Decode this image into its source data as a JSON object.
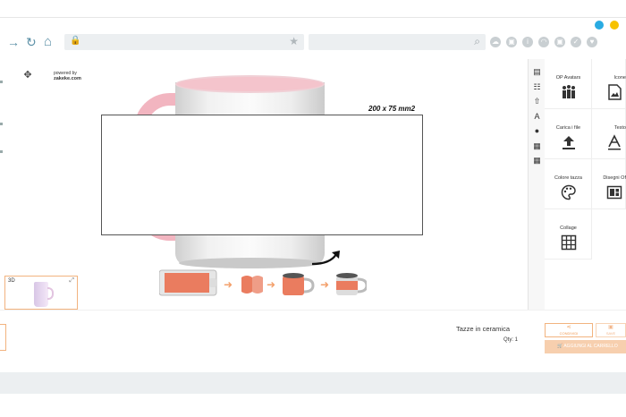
{
  "window": {
    "dot_colors": [
      "#29abe2",
      "#f7c200"
    ]
  },
  "browser": {
    "nav_icons": [
      "→",
      "↻",
      "⌂"
    ],
    "url_value": "",
    "search_value": "",
    "extension_icons": [
      "cloud-icon",
      "camera-icon",
      "info-icon",
      "wifi-icon",
      "camera-icon",
      "shield-icon",
      "heart-icon"
    ]
  },
  "brand": {
    "powered_line": "powered by",
    "brand_name": "zakeke.com"
  },
  "canvas": {
    "print_area_size": "200 x 75 mm2"
  },
  "thumbnail": {
    "label": "3D"
  },
  "tools": [
    {
      "label": "OP Avatars",
      "icon": "avatars-icon",
      "glyph": "👪"
    },
    {
      "label": "Icone",
      "icon": "image-icon",
      "glyph": "🖼"
    },
    {
      "label": "Carica i file",
      "icon": "upload-icon",
      "glyph": "⇧"
    },
    {
      "label": "Testo",
      "icon": "text-icon",
      "glyph": "A"
    },
    {
      "label": "Colore tazza",
      "icon": "palette-icon",
      "glyph": "🎨"
    },
    {
      "label": "Disegni Of",
      "icon": "layout-icon",
      "glyph": "▦"
    },
    {
      "label": "Collage",
      "icon": "grid-icon",
      "glyph": "▦"
    }
  ],
  "product": {
    "name": "Tazze in ceramica",
    "qty": "Qty: 1"
  },
  "actions": {
    "share_label": "CONDIVIDI",
    "save_label": "SAVE",
    "cart_label": "AGGIUNGI AL CARRELLO"
  },
  "colors": {
    "accent": "#f09c56",
    "cart_bg": "#f7cfae",
    "mug_inner": "#f4c4cc",
    "nav_icon": "#5a8fa6"
  }
}
